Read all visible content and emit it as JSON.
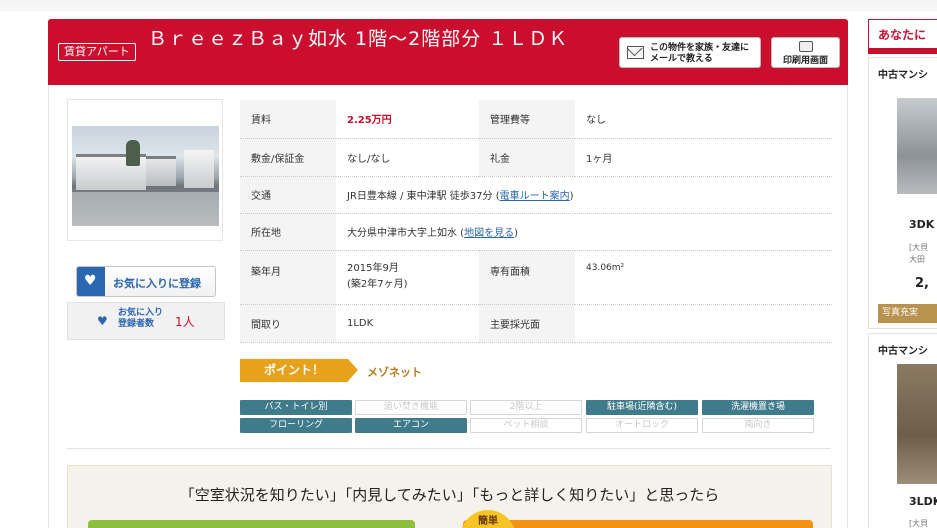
{
  "header": {
    "badge": "賃貸アパート",
    "title": "ＢｒｅｅｚＢａｙ如水 1階～2階部分 １ＬＤＫ",
    "mail_button_line1": "この物件を家族・友達に",
    "mail_button_line2": "メールで教える",
    "print_button": "印刷用画面"
  },
  "favorites": {
    "add_label": "お気に入りに登録",
    "registered_line1": "お気に入り",
    "registered_line2": "登録者数",
    "count": "1人"
  },
  "spec": {
    "rent_label": "賃料",
    "rent_value": "2.25万円",
    "mgmt_label": "管理費等",
    "mgmt_value": "なし",
    "deposit_label": "敷金/保証金",
    "deposit_value": "なし/なし",
    "key_label": "礼金",
    "key_value": "1ヶ月",
    "access_label": "交通",
    "access_value": "JR日豊本線 / 東中津駅 徒歩37分 (",
    "access_link": "電車ルート案内",
    "access_close": ")",
    "address_label": "所在地",
    "address_value": "大分県中津市大字上如水 (",
    "address_link": "地図を見る",
    "address_close": ")",
    "built_label": "築年月",
    "built_value1": "2015年9月",
    "built_value2": "(築2年7ヶ月)",
    "area_label": "専有面積",
    "area_value": "43.06m²",
    "layout_label": "間取り",
    "layout_value": "1LDK",
    "light_label": "主要採光面",
    "light_value": ""
  },
  "point": {
    "label": "ポイント！",
    "value": "メゾネット"
  },
  "tags": [
    {
      "label": "バス・トイレ別",
      "on": true
    },
    {
      "label": "追い焚き機能",
      "on": false
    },
    {
      "label": "2階以上",
      "on": false
    },
    {
      "label": "駐車場(近隣含む)",
      "on": true
    },
    {
      "label": "洗濯機置き場",
      "on": true
    },
    {
      "label": "フローリング",
      "on": true
    },
    {
      "label": "エアコン",
      "on": true
    },
    {
      "label": "ペット相談",
      "on": false
    },
    {
      "label": "オートロック",
      "on": false
    },
    {
      "label": "南向き",
      "on": false
    }
  ],
  "cta": {
    "title": "「空室状況を知りたい」「内見してみたい」「もっと詳しく知りたい」と思ったら",
    "badge": "簡単"
  },
  "sidebar": {
    "header": "あなたに",
    "cards": [
      {
        "category": "中古マンシ",
        "layout": "3DK",
        "addr1": "[大貝",
        "addr2": "大田",
        "price": "2,",
        "more": "写真充実"
      },
      {
        "category": "中古マンシ",
        "layout": "3LDK",
        "addr1": "[大貝",
        "addr2": "",
        "price": "",
        "more": ""
      }
    ]
  }
}
